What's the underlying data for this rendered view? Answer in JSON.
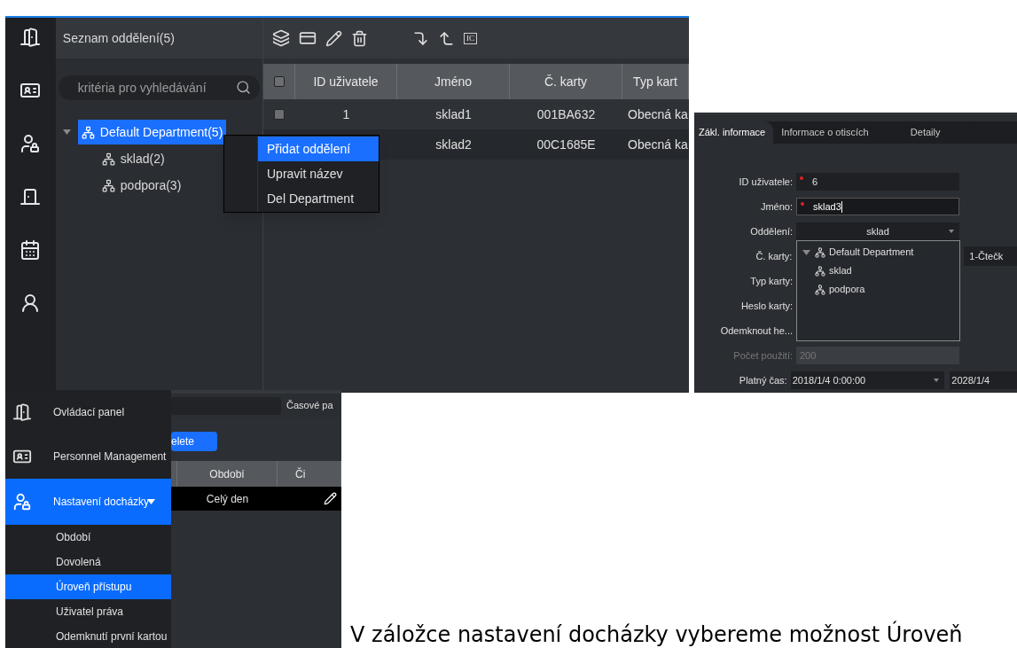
{
  "department_screen": {
    "panel_title": "Seznam oddělení(5)",
    "search": {
      "placeholder": "kritéria pro vyhledávání"
    },
    "tree": [
      {
        "label": "Default Department(5)",
        "selected": true,
        "expanded": true,
        "children": [
          {
            "label": "sklad(2)",
            "selected": false
          },
          {
            "label": "podpora(3)",
            "selected": false
          }
        ]
      }
    ],
    "toolbar_badge": "IC",
    "table": {
      "columns": [
        "ID uživatele",
        "Jméno",
        "Č. karty",
        "Typ kart"
      ],
      "header_checked": false,
      "rows": [
        {
          "checked": false,
          "cells": [
            "1",
            "sklad1",
            "001BA632",
            "Obecná ka"
          ]
        },
        {
          "cells": [
            "",
            "sklad2",
            "00C1685E",
            "Obecná ka"
          ]
        }
      ]
    },
    "context_menu": [
      {
        "label": "Přidat oddělení",
        "selected": true
      },
      {
        "label": "Upravit název",
        "selected": false
      },
      {
        "label": "Del Department",
        "selected": false
      }
    ]
  },
  "user_form": {
    "tabs": [
      {
        "label": "Zákl. informace",
        "selected": true
      },
      {
        "label": "Informace o otiscích",
        "selected": false
      },
      {
        "label": "Detaily",
        "selected": false
      }
    ],
    "fields": [
      {
        "kind": "input",
        "label": "ID uživatele:",
        "required": true,
        "value": "6",
        "focused": false
      },
      {
        "kind": "input",
        "label": "Jméno:",
        "required": true,
        "value": "sklad3",
        "focused": true
      },
      {
        "kind": "select",
        "label": "Oddělení:",
        "value": "sklad",
        "expanded": true
      },
      {
        "kind": "label",
        "label": "Č. karty:"
      },
      {
        "kind": "label",
        "label": "Typ karty:"
      },
      {
        "kind": "label",
        "label": "Heslo karty:"
      },
      {
        "kind": "label",
        "label": "Odemknout he..."
      },
      {
        "kind": "input",
        "label": "Počet použití:",
        "value": "200",
        "disabled": true
      },
      {
        "kind": "date",
        "label": "Platný čas:",
        "value": "2018/1/4 0:00:00",
        "end_value": "2028/1/4"
      }
    ],
    "reader_field": "1-Čtečk",
    "department_dropdown": [
      {
        "label": "Default Department",
        "expanded": true,
        "children": [
          {
            "label": "sklad"
          },
          {
            "label": "podpora"
          }
        ]
      }
    ]
  },
  "attendance_screen": {
    "menu": [
      {
        "label": "Ovládací panel",
        "selected": false
      },
      {
        "label": "Personnel Management",
        "selected": false
      },
      {
        "label": "Nastavení docházky",
        "selected": true,
        "expanded": true,
        "children": [
          {
            "label": "Období",
            "selected": false
          },
          {
            "label": "Dovolená",
            "selected": false
          },
          {
            "label": "Úroveň přístupu",
            "selected": true
          },
          {
            "label": "Uživatel práva",
            "selected": false
          },
          {
            "label": "Odemknutí první kartou",
            "selected": false
          }
        ]
      }
    ],
    "filter_label": "Časové pa",
    "delete_button": "elete",
    "table": {
      "columns": [
        "Období",
        "Či"
      ],
      "rows": [
        {
          "cells": [
            "Celý den"
          ]
        }
      ]
    }
  },
  "document_text": "V záložce nastavení docházky vybereme možnost Úroveň"
}
